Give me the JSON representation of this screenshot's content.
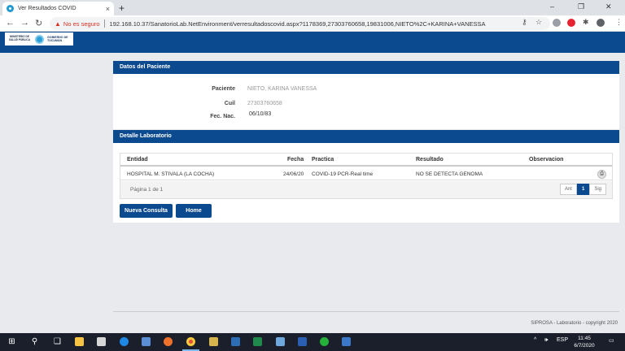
{
  "browser": {
    "tab_title": "Ver Resultados COVID",
    "close_glyph": "×",
    "newtab_glyph": "+",
    "back_glyph": "←",
    "forward_glyph": "→",
    "reload_glyph": "↻",
    "warning_glyph": "▲",
    "security_label": "No es seguro",
    "url": "192.168.10.37/SanatorioLab.NetEnvironment/verresultadoscovid.aspx?1178369,27303760658,19831006,NIETO%2C+KARINA+VANESSA",
    "key_glyph": "⚷",
    "star_glyph": "☆",
    "extensions_glyph": "✱",
    "menu_glyph": "⋮",
    "minimize_glyph": "–",
    "maximize_glyph": "❐",
    "window_close_glyph": "✕"
  },
  "header": {
    "ministry_logo_text": "MINISTERIO DE SALUD PÚBLICA",
    "gov_logo_line1": "GOBIERNO DE",
    "gov_logo_line2": "TUCUMÁN"
  },
  "patient_panel": {
    "title": "Datos del Paciente",
    "fields": [
      {
        "label": "Paciente",
        "value": "NIETO, KARINA VANESSA"
      },
      {
        "label": "Cuil",
        "value": "27303760658"
      },
      {
        "label": "Fec. Nac.",
        "value": "06/10/83"
      }
    ]
  },
  "lab_panel": {
    "title": "Detalle Laboratorio",
    "columns": [
      "Entidad",
      "Fecha",
      "Practica",
      "Resultado",
      "Observacion"
    ],
    "rows": [
      {
        "entidad": "HOSPITAL M. STIVALA (LA COCHA)",
        "fecha": "24/06/20",
        "practica": "COVID-19 PCR-Real time",
        "resultado": "NO SE DETECTA GENOMA",
        "observacion": ""
      }
    ],
    "print_glyph": "⎙",
    "page_info": "Página 1 de 1",
    "pager": {
      "prev": "Ant",
      "current": "1",
      "next": "Sig"
    },
    "buttons": {
      "new_query": "Nueva Consulta",
      "home": "Home"
    }
  },
  "footer": {
    "text": "SIPROSA - Laboratorio - copyright 2020"
  },
  "taskbar": {
    "start_glyph": "⊞",
    "search_glyph": "⚲",
    "taskview_glyph": "❑",
    "tray_up_glyph": "^",
    "volume_glyph": "🕪",
    "language": "ESP",
    "time": "11:45",
    "date": "6/7/2020",
    "notification_glyph": "▭"
  }
}
